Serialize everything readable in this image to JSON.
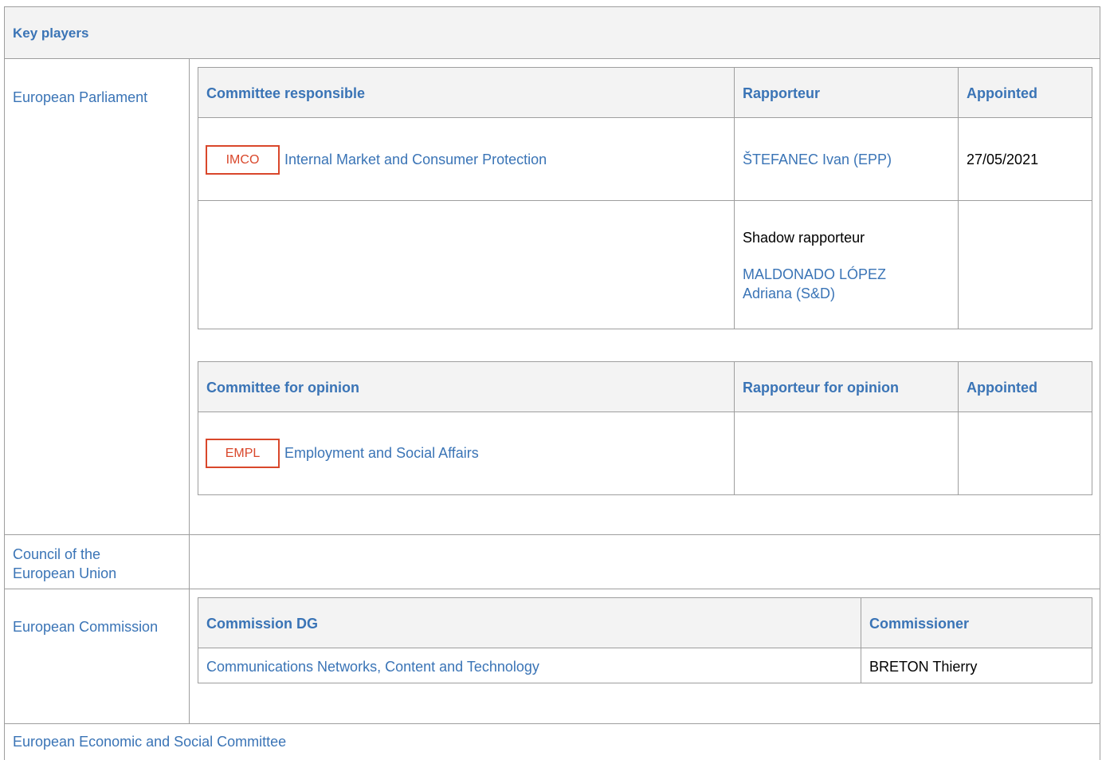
{
  "header": {
    "title": "Key players"
  },
  "ep": {
    "label": "European Parliament",
    "responsible_table": {
      "col_committee": "Committee responsible",
      "col_rapporteur": "Rapporteur",
      "col_appointed": "Appointed",
      "row": {
        "code": "IMCO",
        "committee": "Internal Market and Consumer Protection",
        "rapporteur": "ŠTEFANEC Ivan (EPP)",
        "appointed": "27/05/2021"
      },
      "shadow_label": "Shadow rapporteur",
      "shadow_line1": "MALDONADO LÓPEZ",
      "shadow_line2": "Adriana (S&D)"
    },
    "opinion_table": {
      "col_committee": "Committee for opinion",
      "col_rapporteur": "Rapporteur for opinion",
      "col_appointed": "Appointed",
      "row": {
        "code": "EMPL",
        "committee": "Employment and Social Affairs"
      }
    }
  },
  "council": {
    "line1": "Council of the",
    "line2": "European Union"
  },
  "commission": {
    "label": "European Commission",
    "col_dg": "Commission DG",
    "col_commissioner": "Commissioner",
    "dg": "Communications Networks, Content and Technology",
    "commissioner": "BRETON Thierry"
  },
  "eesc": {
    "label": "European Economic and Social Committee"
  }
}
